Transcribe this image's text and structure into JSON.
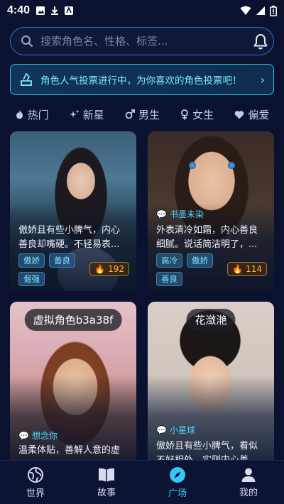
{
  "status_bar": {
    "time": "4:40"
  },
  "search": {
    "placeholder": "搜索角色名、性格、标签..."
  },
  "banner": {
    "text": "角色人气投票进行中，为你喜欢的角色投票吧！",
    "arrow": "›"
  },
  "tabs": [
    {
      "label": "热门",
      "icon": "fire-icon"
    },
    {
      "label": "新星",
      "icon": "sparkle-icon"
    },
    {
      "label": "男生",
      "icon": "male-icon"
    },
    {
      "label": "女生",
      "icon": "female-icon"
    },
    {
      "label": "偏爱",
      "icon": "heart-icon"
    }
  ],
  "cards": [
    {
      "name": "",
      "desc": "傲娇且有些小脾气，内心善良却嘴硬。不轻易表...",
      "tags": [
        "傲娇",
        "善良",
        "倔强"
      ],
      "likes": "192"
    },
    {
      "name": "",
      "author": "书墨未染",
      "desc": "外表清冷如霜，内心善良细腻。说话简洁明了，...",
      "tags": [
        "高冷",
        "傲娇",
        "善良"
      ],
      "likes": "114"
    },
    {
      "name": "虚拟角色b3a38f",
      "author": "想念你",
      "desc": "温柔体贴，善解人意的虚"
    },
    {
      "name": "花潋滟",
      "author": "小星球",
      "desc": "傲娇且有些小脾气，看似不好相处，实则内心善..."
    }
  ],
  "bottom_nav": [
    {
      "label": "世界",
      "icon": "globe-icon",
      "active": false
    },
    {
      "label": "故事",
      "icon": "book-icon",
      "active": false
    },
    {
      "label": "广场",
      "icon": "compass-icon",
      "active": true
    },
    {
      "label": "我的",
      "icon": "user-icon",
      "active": false
    }
  ],
  "colors": {
    "accent": "#37c7f5",
    "background": "#0b1230",
    "banner_text": "#7ee6ff",
    "likes": "#ffb347"
  }
}
